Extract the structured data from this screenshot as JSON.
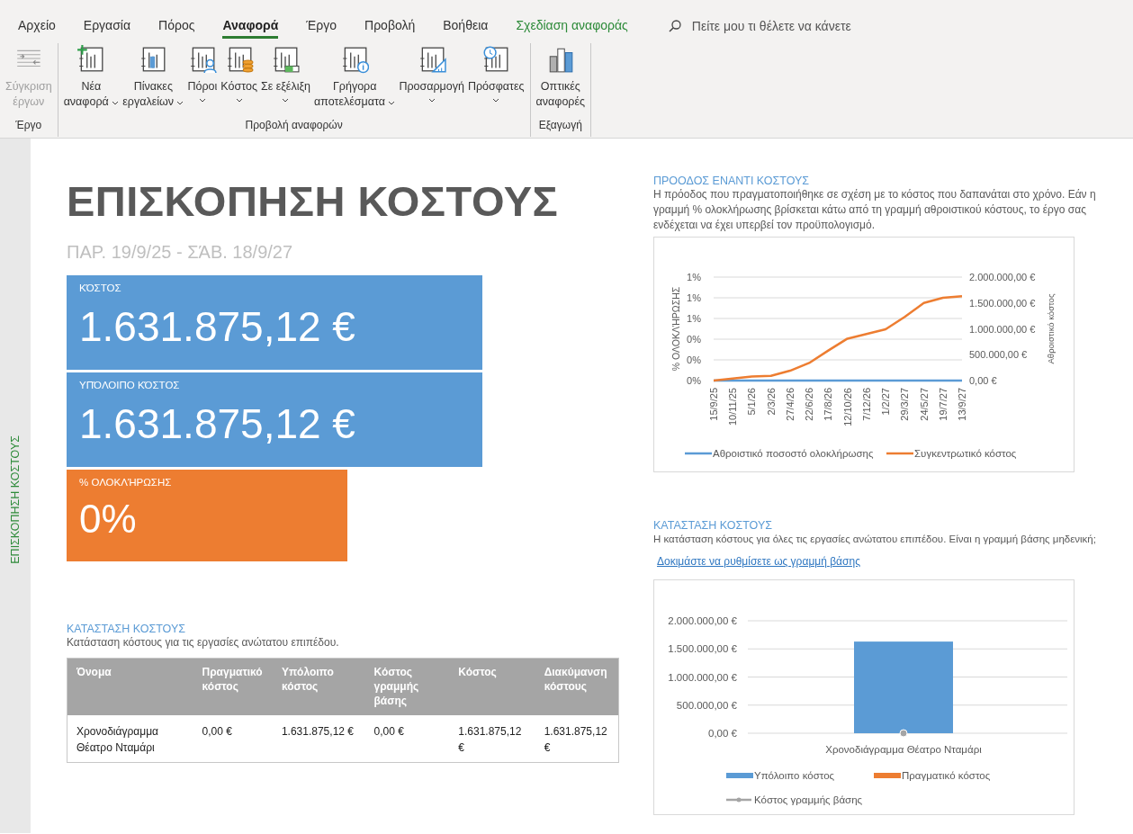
{
  "ribbon": {
    "tabs": [
      {
        "label": "Αρχείο",
        "selected": false,
        "kind": "normal"
      },
      {
        "label": "Εργασία",
        "selected": false,
        "kind": "normal"
      },
      {
        "label": "Πόρος",
        "selected": false,
        "kind": "normal"
      },
      {
        "label": "Αναφορά",
        "selected": true,
        "kind": "normal"
      },
      {
        "label": "Έργο",
        "selected": false,
        "kind": "normal"
      },
      {
        "label": "Προβολή",
        "selected": false,
        "kind": "normal"
      },
      {
        "label": "Βοήθεια",
        "selected": false,
        "kind": "normal"
      },
      {
        "label": "Σχεδίαση αναφοράς",
        "selected": false,
        "kind": "contextual"
      }
    ],
    "search": {
      "placeholder": "Πείτε μου τι θέλετε να κάνετε"
    },
    "groups": [
      {
        "label": "Έργο",
        "buttons": [
          {
            "lines": [
              "Σύγκριση",
              "έργων"
            ],
            "dropdown": false,
            "disabled": true
          }
        ]
      },
      {
        "label": "Προβολή αναφορών",
        "buttons": [
          {
            "lines": [
              "Νέα",
              "αναφορά"
            ],
            "dropdown": true,
            "disabled": false
          },
          {
            "lines": [
              "Πίνακες",
              "εργαλείων"
            ],
            "dropdown": true,
            "disabled": false
          },
          {
            "lines": [
              "Πόροι"
            ],
            "dropdown": true,
            "disabled": false
          },
          {
            "lines": [
              "Κόστος"
            ],
            "dropdown": true,
            "disabled": false
          },
          {
            "lines": [
              "Σε εξέλιξη"
            ],
            "dropdown": true,
            "disabled": false
          },
          {
            "lines": [
              "Γρήγορα",
              "αποτελέσματα"
            ],
            "dropdown": true,
            "disabled": false
          },
          {
            "lines": [
              "Προσαρμογή"
            ],
            "dropdown": true,
            "disabled": false
          },
          {
            "lines": [
              "Πρόσφατες"
            ],
            "dropdown": true,
            "disabled": false
          }
        ]
      },
      {
        "label": "Εξαγωγή",
        "buttons": [
          {
            "lines": [
              "Οπτικές",
              "αναφορές"
            ],
            "dropdown": false,
            "disabled": false
          }
        ]
      }
    ]
  },
  "side_label": "ΕΠΙΣΚΟΠΗΣΗ ΚΟΣΤΟΥΣ",
  "report": {
    "title": "ΕΠΙΣΚΟΠΗΣΗ ΚΟΣΤΟΥΣ",
    "date_range": "ΠΑΡ. 19/9/25 -  ΣΆΒ. 18/9/27",
    "kpis": [
      {
        "label": "ΚΌΣΤΟΣ",
        "value": "1.631.875,12 €",
        "color": "#5b9bd5",
        "kind": "wide"
      },
      {
        "label": "ΥΠΌΛΟΙΠΟ ΚΌΣΤΟΣ",
        "value": "1.631.875,12 €",
        "color": "#5b9bd5",
        "kind": "wide"
      },
      {
        "label": "% ΟΛΟΚΛΉΡΩΣΗΣ",
        "value": "0%",
        "color": "#ed7d31",
        "kind": "narrow"
      }
    ],
    "cost_table": {
      "heading": "ΚΑΤΑΣΤΑΣΗ ΚΟΣΤΟΥΣ",
      "description": "Κατάσταση κόστους για τις εργασίες ανώτατου επιπέδου.",
      "columns": [
        "Όνομα",
        "Πραγματικό κόστος",
        "Υπόλοιπο κόστος",
        "Κόστος γραμμής βάσης",
        "Κόστος",
        "Διακύμανση κόστους"
      ],
      "rows": [
        [
          "Χρονοδιάγραμμα Θέατρο Νταμάρι",
          "0,00 €",
          "1.631.875,12 €",
          "0,00 €",
          "1.631.875,12 €",
          "1.631.875,12 €"
        ]
      ]
    },
    "progress": {
      "heading": "ΠΡΟΟΔΟΣ ΕΝΑΝΤΙ ΚΟΣΤΟΥΣ",
      "description": "Η πρόοδος που πραγματοποιήθηκε σε σχέση με το κόστος που δαπανάται στο χρόνο. Εάν η γραμμή % ολοκλήρωσης βρίσκεται κάτω από τη γραμμή αθροιστικού κόστους, το έργο σας ενδέχεται να έχει υπερβεί τον προϋπολογισμό.",
      "chart_data": {
        "type": "line",
        "ylabel": "% ΟΛΟΚΛΉΡΩΣΗΣ",
        "y2label": "Αθροιστικό κόστος",
        "x": [
          "15/9/25",
          "10/11/25",
          "5/1/26",
          "2/3/26",
          "27/4/26",
          "22/6/26",
          "17/8/26",
          "12/10/26",
          "7/12/26",
          "1/2/27",
          "29/3/27",
          "24/5/27",
          "19/7/27",
          "13/9/27"
        ],
        "grid": true,
        "series": [
          {
            "name": "Αθροιστικό ποσοστό ολοκλήρωσης",
            "color": "#5b9bd5",
            "values": [
              0,
              0,
              0,
              0,
              0,
              0,
              0,
              0,
              0,
              0,
              0,
              0,
              0,
              0
            ]
          },
          {
            "name": "Συγκεντρωτικό κόστος",
            "color": "#ed7d31",
            "axis": "y2",
            "values": [
              0,
              40000,
              80000,
              90000,
              190000,
              340000,
              580000,
              810000,
              900000,
              990000,
              1230000,
              1500000,
              1600000,
              1630000
            ]
          }
        ],
        "legend": "bottom",
        "ylim": [
          0,
          0.01
        ],
        "yticks": [
          {
            "value": 0,
            "label": "0%"
          },
          {
            "value": 0.002,
            "label": "0%"
          },
          {
            "value": 0.004,
            "label": "0%"
          },
          {
            "value": 0.006,
            "label": "1%"
          },
          {
            "value": 0.008,
            "label": "1%"
          },
          {
            "value": 0.01,
            "label": "1%"
          }
        ],
        "y2lim": [
          0,
          2000000
        ],
        "y2ticks": [
          {
            "value": 0,
            "label": "0,00 €"
          },
          {
            "value": 500000,
            "label": "500.000,00 €"
          },
          {
            "value": 1000000,
            "label": "1.000.000,00 €"
          },
          {
            "value": 1500000,
            "label": "1.500.000,00 €"
          },
          {
            "value": 2000000,
            "label": "2.000.000,00 €"
          }
        ]
      }
    },
    "status": {
      "heading": "ΚΑΤΑΣΤΑΣΗ ΚΟΣΤΟΥΣ",
      "description": "Η κατάσταση κόστους για όλες τις εργασίες ανώτατου επιπέδου. Είναι η γραμμή βάσης μηδενική;",
      "link": "Δοκιμάστε να ρυθμίσετε ως γραμμή βάσης",
      "chart_data": {
        "type": "bar",
        "categories": [
          "Χρονοδιάγραμμα Θέατρο Νταμάρι"
        ],
        "grid": true,
        "series": [
          {
            "name": "Υπόλοιπο κόστος",
            "color": "#5b9bd5",
            "values": [
              1630000
            ]
          },
          {
            "name": "Πραγματικό κόστος",
            "color": "#ed7d31",
            "values": [
              0
            ]
          },
          {
            "name": "Κόστος γραμμής βάσης",
            "color": "#a5a5a5",
            "type": "line",
            "marker": "circle",
            "values": [
              0
            ]
          }
        ],
        "legend": "bottom",
        "stacked": true,
        "ylim": [
          0,
          2000000
        ],
        "yticks": [
          {
            "value": 0,
            "label": "0,00 €"
          },
          {
            "value": 500000,
            "label": "500.000,00 €"
          },
          {
            "value": 1000000,
            "label": "1.000.000,00 €"
          },
          {
            "value": 1500000,
            "label": "1.500.000,00 €"
          },
          {
            "value": 2000000,
            "label": "2.000.000,00 €"
          }
        ]
      }
    }
  }
}
